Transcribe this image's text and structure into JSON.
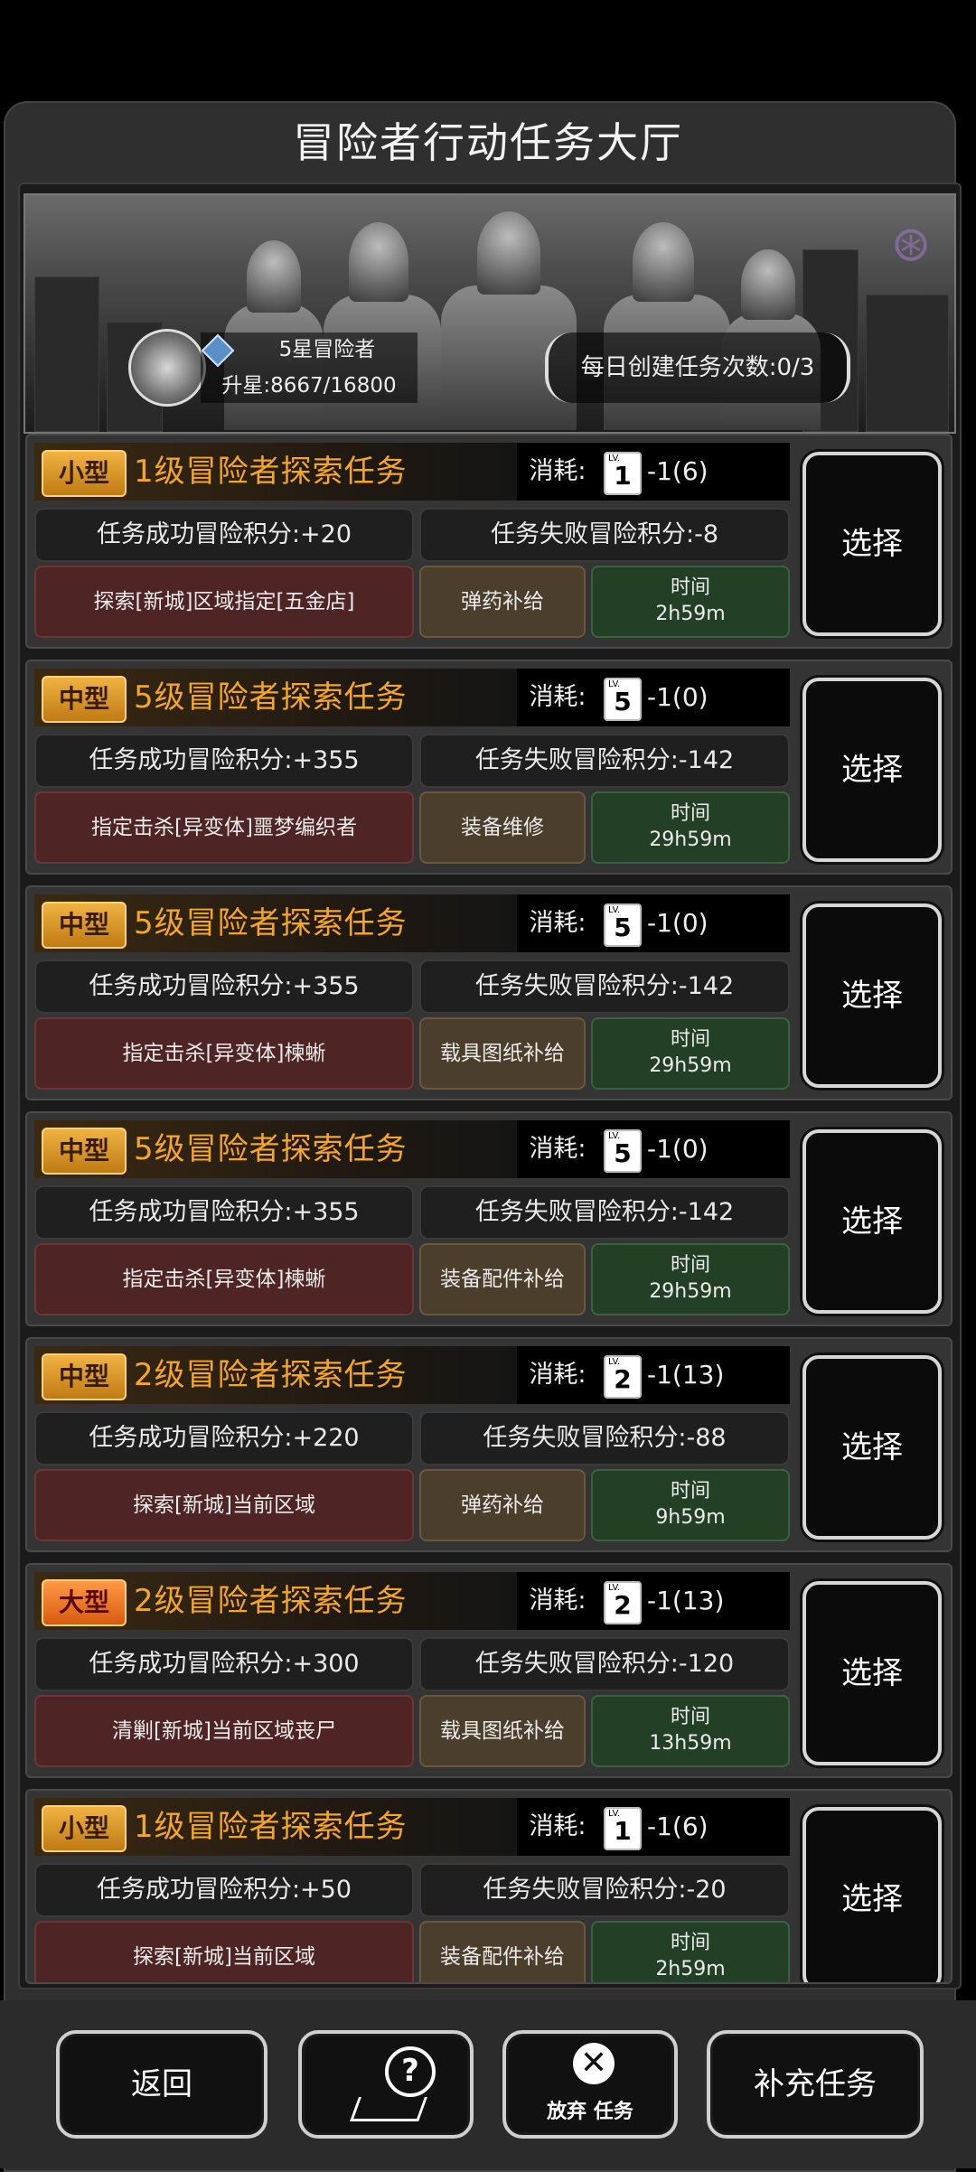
{
  "title": "冒险者行动任务大厅",
  "rank": {
    "name": "5星冒险者",
    "progress": "升星:8667/16800"
  },
  "daily": "每日创建任务次数:0/3",
  "cost_label": "消耗:",
  "select_label": "选择",
  "time_label": "时间",
  "tasks": [
    {
      "size": "小型",
      "name": "1级冒险者探索任务",
      "lv": "1",
      "cost": "-1(6)",
      "success": "任务成功冒险积分:+20",
      "fail": "任务失败冒险积分:-8",
      "target": "探索[新城]区域指定[五金店]",
      "reward": "弹药补给",
      "time": "2h59m"
    },
    {
      "size": "中型",
      "name": "5级冒险者探索任务",
      "lv": "5",
      "cost": "-1(0)",
      "success": "任务成功冒险积分:+355",
      "fail": "任务失败冒险积分:-142",
      "target": "指定击杀[异变体]噩梦编织者",
      "reward": "装备维修",
      "time": "29h59m"
    },
    {
      "size": "中型",
      "name": "5级冒险者探索任务",
      "lv": "5",
      "cost": "-1(0)",
      "success": "任务成功冒险积分:+355",
      "fail": "任务失败冒险积分:-142",
      "target": "指定击杀[异变体]楝蜥",
      "reward": "载具图纸补给",
      "time": "29h59m"
    },
    {
      "size": "中型",
      "name": "5级冒险者探索任务",
      "lv": "5",
      "cost": "-1(0)",
      "success": "任务成功冒险积分:+355",
      "fail": "任务失败冒险积分:-142",
      "target": "指定击杀[异变体]楝蜥",
      "reward": "装备配件补给",
      "time": "29h59m"
    },
    {
      "size": "中型",
      "name": "2级冒险者探索任务",
      "lv": "2",
      "cost": "-1(13)",
      "success": "任务成功冒险积分:+220",
      "fail": "任务失败冒险积分:-88",
      "target": "探索[新城]当前区域",
      "reward": "弹药补给",
      "time": "9h59m"
    },
    {
      "size": "大型",
      "name": "2级冒险者探索任务",
      "lv": "2",
      "cost": "-1(13)",
      "success": "任务成功冒险积分:+300",
      "fail": "任务失败冒险积分:-120",
      "target": "清剿[新城]当前区域丧尸",
      "reward": "载具图纸补给",
      "time": "13h59m"
    },
    {
      "size": "小型",
      "name": "1级冒险者探索任务",
      "lv": "1",
      "cost": "-1(6)",
      "success": "任务成功冒险积分:+50",
      "fail": "任务失败冒险积分:-20",
      "target": "探索[新城]当前区域",
      "reward": "装备配件补给",
      "time": "2h59m"
    }
  ],
  "buttons": {
    "back": "返回",
    "abandon": "放弃 任务",
    "refill": "补充任务"
  },
  "icons": {
    "help": "help-map-icon",
    "abandon": "close-circle-icon"
  },
  "colors": {
    "task_name": "#f5a623",
    "target_bg": "#4e2424",
    "reward_bg": "#4c3e2c",
    "time_bg": "#234026"
  }
}
